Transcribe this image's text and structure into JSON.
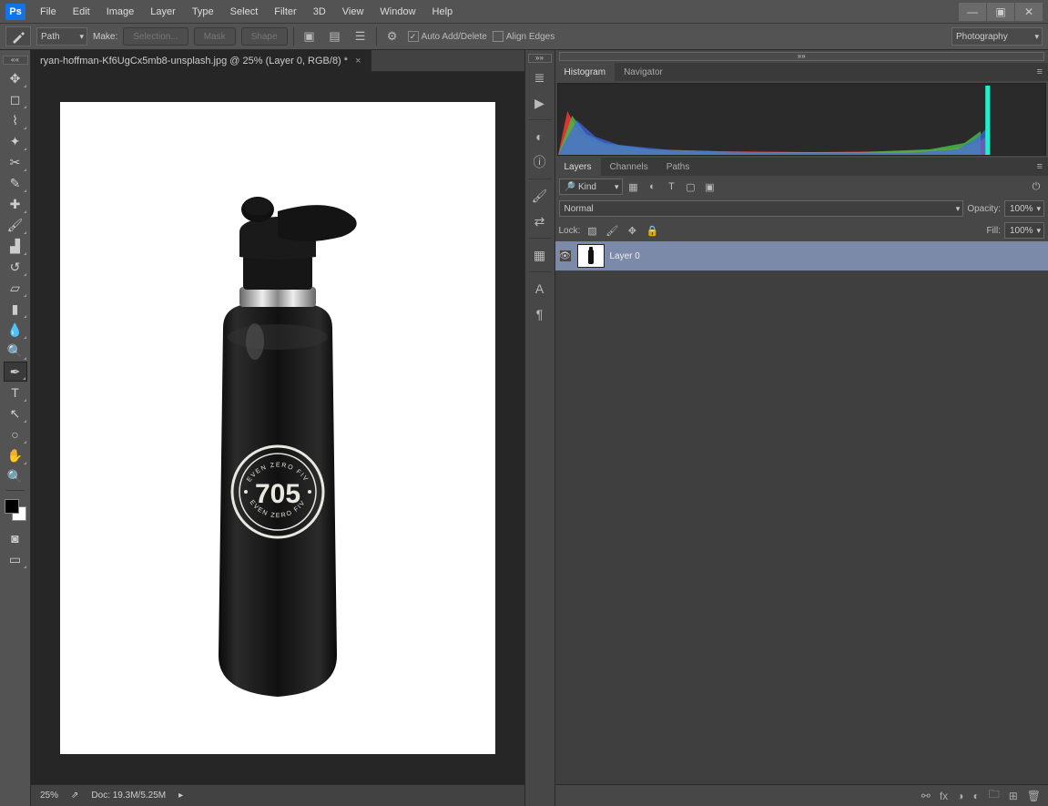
{
  "menu": {
    "items": [
      "File",
      "Edit",
      "Image",
      "Layer",
      "Type",
      "Select",
      "Filter",
      "3D",
      "View",
      "Window",
      "Help"
    ]
  },
  "window_controls": {
    "min": "—",
    "max": "▣",
    "close": "✕"
  },
  "options": {
    "mode": "Path",
    "make_label": "Make:",
    "selection": "Selection...",
    "mask": "Mask",
    "shape": "Shape",
    "auto_add": "Auto Add/Delete",
    "align_edges": "Align Edges",
    "workspace_mode": "Photography"
  },
  "document": {
    "tab_title": "ryan-hoffman-Kf6UgCx5mb8-unsplash.jpg @ 25% (Layer 0, RGB/8) *"
  },
  "status": {
    "zoom": "25%",
    "doc": "Doc: 19.3M/5.25M"
  },
  "panel_tabs": {
    "histogram": "Histogram",
    "navigator": "Navigator",
    "layers": "Layers",
    "channels": "Channels",
    "paths": "Paths"
  },
  "layers": {
    "kind": "Kind",
    "blend": "Normal",
    "opacity_label": "Opacity:",
    "opacity_value": "100%",
    "lock_label": "Lock:",
    "fill_label": "Fill:",
    "fill_value": "100%",
    "rows": [
      {
        "name": "Layer 0"
      }
    ]
  },
  "bottle": {
    "logo_number": "705",
    "logo_top": "SEVEN ZERO FIVE",
    "logo_bottom": "SEVEN ZERO FIVE"
  }
}
